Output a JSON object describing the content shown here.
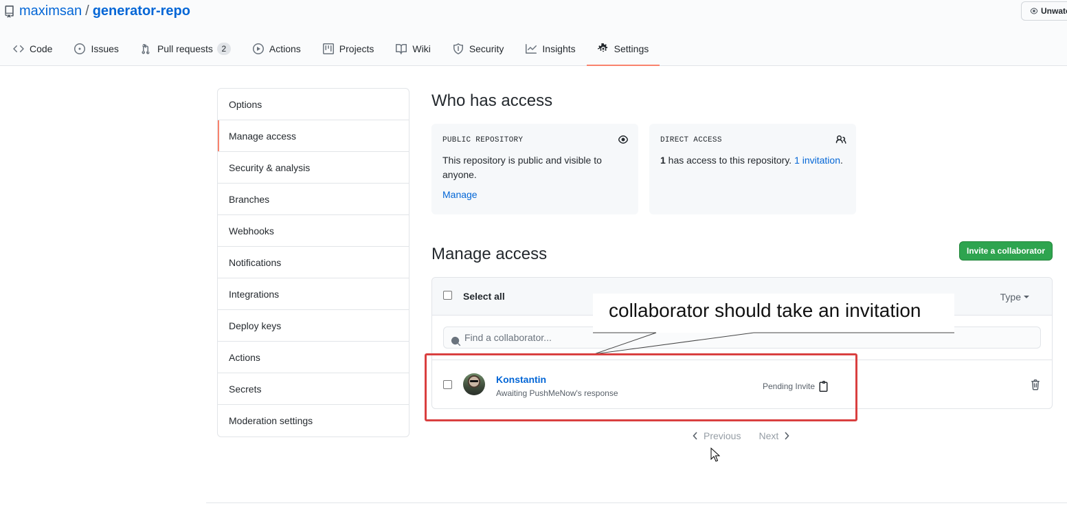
{
  "repo": {
    "owner": "maximsan",
    "separator": "/",
    "name": "generator-repo"
  },
  "watch_button": {
    "label": "Unwatch"
  },
  "tabs": [
    {
      "label": "Code",
      "icon": "code-icon"
    },
    {
      "label": "Issues",
      "icon": "issue-icon"
    },
    {
      "label": "Pull requests",
      "icon": "pull-request-icon",
      "count": "2"
    },
    {
      "label": "Actions",
      "icon": "play-icon"
    },
    {
      "label": "Projects",
      "icon": "project-icon"
    },
    {
      "label": "Wiki",
      "icon": "book-icon"
    },
    {
      "label": "Security",
      "icon": "shield-icon"
    },
    {
      "label": "Insights",
      "icon": "graph-icon"
    },
    {
      "label": "Settings",
      "icon": "gear-icon",
      "selected": true
    }
  ],
  "sidebar": {
    "items": [
      {
        "label": "Options"
      },
      {
        "label": "Manage access",
        "selected": true
      },
      {
        "label": "Security & analysis"
      },
      {
        "label": "Branches"
      },
      {
        "label": "Webhooks"
      },
      {
        "label": "Notifications"
      },
      {
        "label": "Integrations"
      },
      {
        "label": "Deploy keys"
      },
      {
        "label": "Actions"
      },
      {
        "label": "Secrets"
      },
      {
        "label": "Moderation settings"
      }
    ]
  },
  "who_has_access": {
    "title": "Who has access",
    "public_card": {
      "label": "PUBLIC REPOSITORY",
      "text": "This repository is public and visible to anyone.",
      "link": "Manage"
    },
    "direct_card": {
      "label": "DIRECT ACCESS",
      "count": "1",
      "text": " has access to this repository. ",
      "link": "1 invitation",
      "suffix": "."
    }
  },
  "manage_access": {
    "title": "Manage access",
    "invite_button": "Invite a collaborator",
    "select_all": "Select all",
    "type_filter": "Type",
    "search_placeholder": "Find a collaborator...",
    "members": [
      {
        "name": "Konstantin",
        "status": "Awaiting PushMeNow's response",
        "badge": "Pending Invite"
      }
    ],
    "pagination": {
      "previous": "Previous",
      "next": "Next"
    }
  },
  "annotation": {
    "text": "collaborator should take an invitation"
  },
  "colors": {
    "accent_tab": "#f9826c",
    "link": "#0366d6",
    "primary_button": "#2ea44f",
    "annotation_border": "#d93f3f"
  }
}
